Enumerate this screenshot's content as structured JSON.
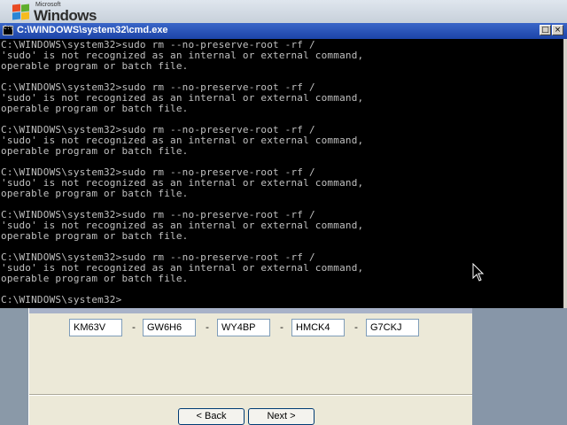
{
  "desktop": {
    "logo_small": "Microsoft",
    "logo_text": "Windows",
    "logo_colors": [
      "#e94b24",
      "#5fae2e",
      "#2b86d6",
      "#f6bb1e"
    ]
  },
  "cmd_window": {
    "title": "C:\\WINDOWS\\system32\\cmd.exe",
    "buttons": {
      "restore": "□",
      "close": "×"
    },
    "lines": [
      "C:\\WINDOWS\\system32>sudo rm --no-preserve-root -rf /",
      "'sudo' is not recognized as an internal or external command,",
      "operable program or batch file.",
      "",
      "C:\\WINDOWS\\system32>sudo rm --no-preserve-root -rf /",
      "'sudo' is not recognized as an internal or external command,",
      "operable program or batch file.",
      "",
      "C:\\WINDOWS\\system32>sudo rm --no-preserve-root -rf /",
      "'sudo' is not recognized as an internal or external command,",
      "operable program or batch file.",
      "",
      "C:\\WINDOWS\\system32>sudo rm --no-preserve-root -rf /",
      "'sudo' is not recognized as an internal or external command,",
      "operable program or batch file.",
      "",
      "C:\\WINDOWS\\system32>sudo rm --no-preserve-root -rf /",
      "'sudo' is not recognized as an internal or external command,",
      "operable program or batch file.",
      "",
      "C:\\WINDOWS\\system32>sudo rm --no-preserve-root -rf /",
      "'sudo' is not recognized as an internal or external command,",
      "operable program or batch file.",
      "",
      "C:\\WINDOWS\\system32>"
    ]
  },
  "wizard": {
    "product_key": [
      "KM63V",
      "GW6H6",
      "WY4BP",
      "HMCK4",
      "G7CKJ"
    ],
    "separator": "-",
    "back_label": "< Back",
    "next_label": "Next >"
  }
}
